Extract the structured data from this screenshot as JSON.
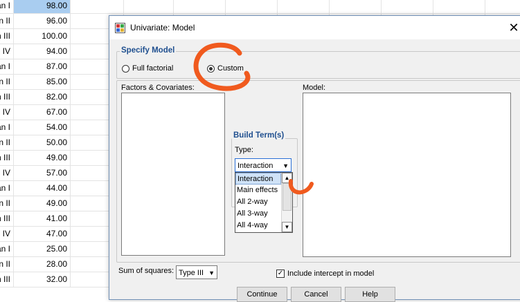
{
  "spreadsheet": {
    "rows": [
      {
        "label": "an I",
        "value": "98.00",
        "selected": true
      },
      {
        "label": "an II",
        "value": "96.00"
      },
      {
        "label": "n III",
        "value": "100.00"
      },
      {
        "label": "IV",
        "value": "94.00"
      },
      {
        "label": "an I",
        "value": "87.00"
      },
      {
        "label": "an II",
        "value": "85.00"
      },
      {
        "label": "n III",
        "value": "82.00"
      },
      {
        "label": "IV",
        "value": "67.00"
      },
      {
        "label": "an I",
        "value": "54.00"
      },
      {
        "label": "an II",
        "value": "50.00"
      },
      {
        "label": "n III",
        "value": "49.00"
      },
      {
        "label": "IV",
        "value": "57.00"
      },
      {
        "label": "an I",
        "value": "44.00"
      },
      {
        "label": "an II",
        "value": "49.00"
      },
      {
        "label": "n III",
        "value": "41.00"
      },
      {
        "label": "IV",
        "value": "47.00"
      },
      {
        "label": "an I",
        "value": "25.00"
      },
      {
        "label": "an II",
        "value": "28.00"
      },
      {
        "label": "n III",
        "value": "32.00"
      }
    ]
  },
  "dialog": {
    "title": "Univariate: Model",
    "close_glyph": "✕",
    "specify_model": {
      "legend": "Specify Model",
      "full_factorial": "Full factorial",
      "custom": "Custom",
      "selected": "custom"
    },
    "factors_label": "Factors & Covariates:",
    "model_label": "Model:",
    "build_terms": {
      "legend": "Build Term(s)",
      "type_label": "Type:",
      "type_value": "Interaction",
      "options": [
        "Interaction",
        "Main effects",
        "All 2-way",
        "All 3-way",
        "All 4-way"
      ],
      "highlighted": 0
    },
    "sum_of_squares_label": "Sum of squares:",
    "sum_of_squares_value": "Type III",
    "include_intercept": {
      "label": "Include intercept in model",
      "checked": true
    },
    "footer_buttons": [
      "Continue",
      "Cancel",
      "Help"
    ]
  },
  "colors": {
    "annotation": "#f05a1e",
    "legend_text": "#1f4f8f",
    "selection": "#a9cdf0"
  },
  "icons": {
    "app": "spss-app-icon",
    "close": "close-icon",
    "dropdown": "chevron-down-icon"
  }
}
